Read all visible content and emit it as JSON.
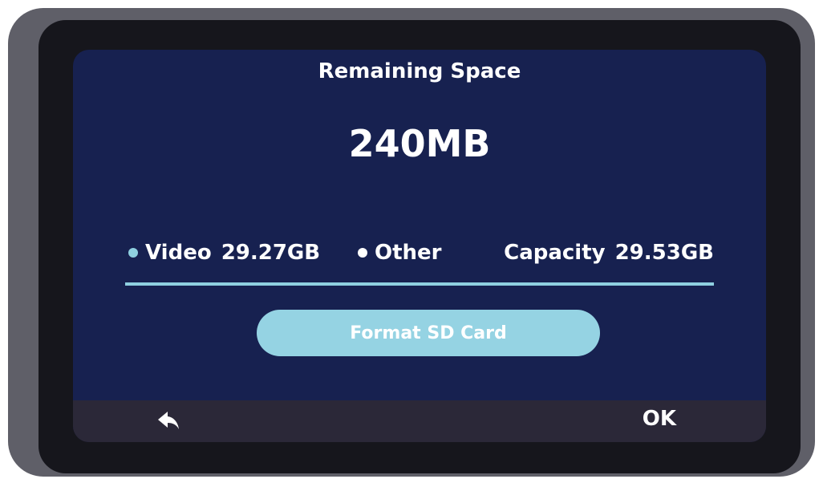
{
  "header": {
    "title": "Remaining Space"
  },
  "remaining": {
    "value": "240MB"
  },
  "legend": {
    "video_label": "Video",
    "video_size": "29.27GB",
    "video_color": "#8fd0e0",
    "other_label": "Other",
    "other_color": "#ffffff",
    "capacity_label": "Capacity",
    "capacity_size": "29.53GB"
  },
  "actions": {
    "format_label": "Format SD Card",
    "ok_label": "OK",
    "back_icon": "back-arrow-icon"
  },
  "colors": {
    "screen_bg": "#172150",
    "accent": "#95d3e3",
    "bottom_bar": "#2b2838"
  }
}
